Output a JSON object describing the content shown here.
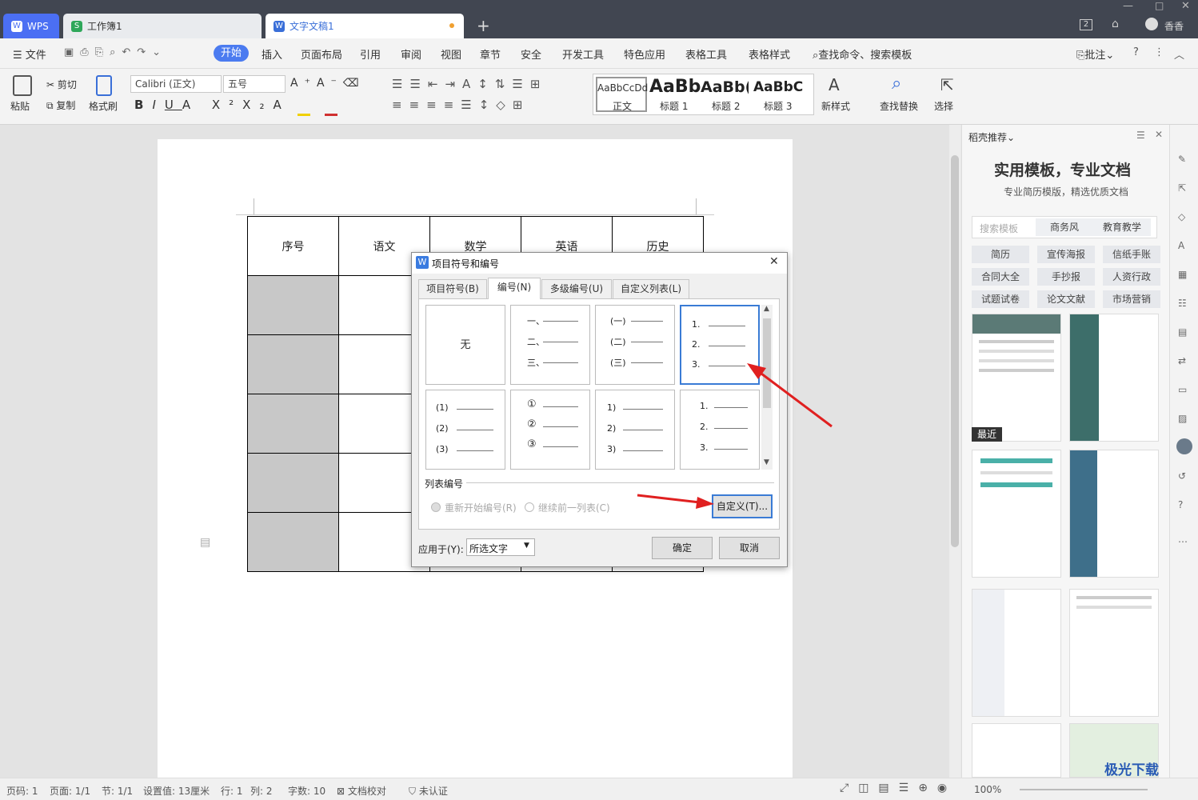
{
  "titlebar": {
    "wps_tab": "WPS",
    "workbook_tab": "工作簿1",
    "doc_tab": "文字文稿1",
    "badge": "2",
    "user": "香香"
  },
  "menu": {
    "file": "文件",
    "items": [
      "开始",
      "插入",
      "页面布局",
      "引用",
      "审阅",
      "视图",
      "章节",
      "安全",
      "开发工具",
      "特色应用",
      "表格工具",
      "表格样式"
    ],
    "search": "查找命令、搜索模板",
    "comment": "批注"
  },
  "ribbon": {
    "paste": "粘贴",
    "cut": "剪切",
    "copy": "复制",
    "format_painter": "格式刷",
    "font": "Calibri (正文)",
    "size": "五号",
    "styles": [
      {
        "preview": "AaBbCcDd",
        "label": "正文"
      },
      {
        "preview": "AaBb",
        "label": "标题 1"
      },
      {
        "preview": "AaBb(",
        "label": "标题 2"
      },
      {
        "preview": "AaBbC(",
        "label": "标题 3"
      }
    ],
    "new_style": "新样式",
    "find_replace": "查找替换",
    "select": "选择"
  },
  "table": {
    "headers": [
      "序号",
      "语文",
      "数学",
      "英语",
      "历史"
    ]
  },
  "dialog": {
    "title": "项目符号和编号",
    "tabs": [
      "项目符号(B)",
      "编号(N)",
      "多级编号(U)",
      "自定义列表(L)"
    ],
    "none_label": "无",
    "gallery": [
      [
        "一、",
        "二、",
        "三、"
      ],
      [
        "(一)",
        "(二)",
        "(三)"
      ],
      [
        "1.",
        "2.",
        "3."
      ],
      [
        "(1)",
        "(2)",
        "(3)"
      ],
      [
        "①",
        "②",
        "③"
      ],
      [
        "1)",
        "2)",
        "3)"
      ],
      [
        "1.",
        "2.",
        "3."
      ]
    ],
    "list_section": "列表编号",
    "restart": "重新开始编号(R)",
    "continue": "继续前一列表(C)",
    "customize": "自定义(T)...",
    "apply_label": "应用于(Y):",
    "apply_value": "所选文字",
    "ok": "确定",
    "cancel": "取消"
  },
  "pane": {
    "header": "稻壳推荐",
    "headline": "实用模板，专业文档",
    "subline": "专业简历模版，精选优质文档",
    "search_placeholder": "搜索模板",
    "tag1": "商务风",
    "tag2": "教育教学",
    "chips": [
      "简历",
      "宣传海报",
      "信纸手账",
      "合同大全",
      "手抄报",
      "人资行政",
      "试题试卷",
      "论文文献",
      "市场营销"
    ],
    "recent": "最近",
    "watermark": "极光下载站"
  },
  "status": {
    "page": "页码: 1",
    "pages": "页面: 1/1",
    "section": "节: 1/1",
    "setting": "设置值: 13厘米",
    "row": "行: 1",
    "col": "列: 2",
    "words": "字数: 10",
    "proof": "文档校对",
    "cert": "未认证",
    "zoom": "100%"
  }
}
